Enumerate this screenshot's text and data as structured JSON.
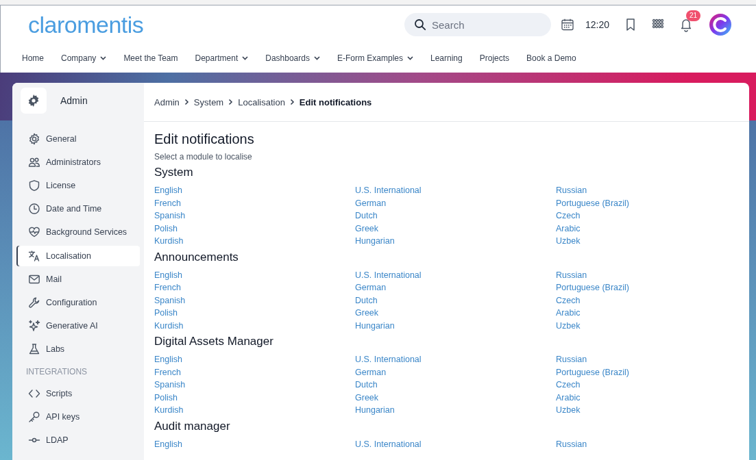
{
  "header": {
    "logo": "claromentis",
    "search": {
      "placeholder": "Search"
    },
    "time": "12:20",
    "notification_count": "21"
  },
  "nav": [
    {
      "label": "Home",
      "dropdown": false
    },
    {
      "label": "Company",
      "dropdown": true
    },
    {
      "label": "Meet the Team",
      "dropdown": false
    },
    {
      "label": "Department",
      "dropdown": true
    },
    {
      "label": "Dashboards",
      "dropdown": true
    },
    {
      "label": "E-Form Examples",
      "dropdown": true
    },
    {
      "label": "Learning",
      "dropdown": false
    },
    {
      "label": "Projects",
      "dropdown": false
    },
    {
      "label": "Book a Demo",
      "dropdown": false
    }
  ],
  "sidebar": {
    "title": "Admin",
    "items": [
      {
        "kind": "item",
        "label": "General",
        "selected": false
      },
      {
        "kind": "item",
        "label": "Administrators",
        "selected": false
      },
      {
        "kind": "item",
        "label": "License",
        "selected": false
      },
      {
        "kind": "item",
        "label": "Date and Time",
        "selected": false
      },
      {
        "kind": "item",
        "label": "Background Services",
        "selected": false
      },
      {
        "kind": "item",
        "label": "Localisation",
        "selected": true
      },
      {
        "kind": "item",
        "label": "Mail",
        "selected": false
      },
      {
        "kind": "item",
        "label": "Configuration",
        "selected": false
      },
      {
        "kind": "item",
        "label": "Generative AI",
        "selected": false
      },
      {
        "kind": "item",
        "label": "Labs",
        "selected": false
      },
      {
        "kind": "heading",
        "label": "INTEGRATIONS"
      },
      {
        "kind": "item",
        "label": "Scripts",
        "selected": false
      },
      {
        "kind": "item",
        "label": "API keys",
        "selected": false
      },
      {
        "kind": "item",
        "label": "LDAP",
        "selected": false
      }
    ]
  },
  "breadcrumb": [
    {
      "label": "Admin",
      "current": false
    },
    {
      "label": "System",
      "current": false
    },
    {
      "label": "Localisation",
      "current": false
    },
    {
      "label": "Edit notifications",
      "current": true
    }
  ],
  "page": {
    "title": "Edit notifications",
    "subtitle": "Select a module to localise"
  },
  "modules": [
    {
      "title": "System",
      "columns": [
        [
          "English",
          "French",
          "Spanish",
          "Polish",
          "Kurdish"
        ],
        [
          "U.S. International",
          "German",
          "Dutch",
          "Greek",
          "Hungarian"
        ],
        [
          "Russian",
          "Portuguese (Brazil)",
          "Czech",
          "Arabic",
          "Uzbek"
        ]
      ]
    },
    {
      "title": "Announcements",
      "columns": [
        [
          "English",
          "French",
          "Spanish",
          "Polish",
          "Kurdish"
        ],
        [
          "U.S. International",
          "German",
          "Dutch",
          "Greek",
          "Hungarian"
        ],
        [
          "Russian",
          "Portuguese (Brazil)",
          "Czech",
          "Arabic",
          "Uzbek"
        ]
      ]
    },
    {
      "title": "Digital Assets Manager",
      "columns": [
        [
          "English",
          "French",
          "Spanish",
          "Polish",
          "Kurdish"
        ],
        [
          "U.S. International",
          "German",
          "Dutch",
          "Greek",
          "Hungarian"
        ],
        [
          "Russian",
          "Portuguese (Brazil)",
          "Czech",
          "Arabic",
          "Uzbek"
        ]
      ]
    },
    {
      "title": "Audit manager",
      "columns": [
        [
          "English"
        ],
        [
          "U.S. International"
        ],
        [
          "Russian"
        ]
      ]
    }
  ]
}
